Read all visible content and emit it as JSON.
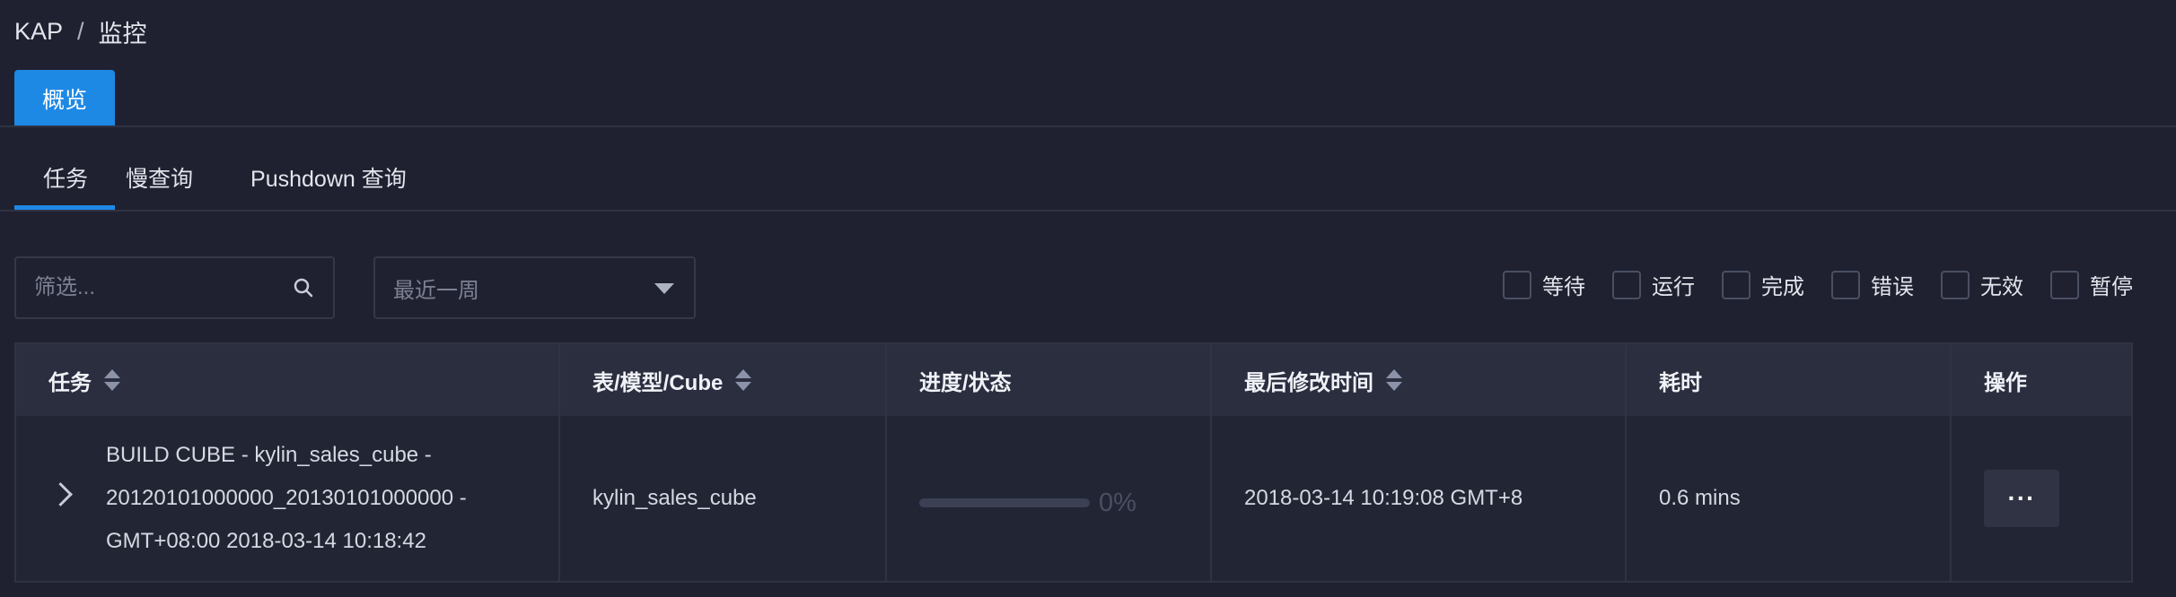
{
  "breadcrumb": {
    "root": "KAP",
    "separator": "/",
    "current": "监控"
  },
  "main_tab": {
    "label": "概览"
  },
  "subtabs": [
    {
      "label": "任务",
      "active": true
    },
    {
      "label": "慢查询",
      "active": false
    },
    {
      "label": "Pushdown 查询",
      "active": false
    }
  ],
  "filter": {
    "placeholder": "筛选...",
    "value": ""
  },
  "period_select": {
    "value": "最近一周"
  },
  "status_filters": [
    {
      "label": "等待",
      "checked": false
    },
    {
      "label": "运行",
      "checked": false
    },
    {
      "label": "完成",
      "checked": false
    },
    {
      "label": "错误",
      "checked": false
    },
    {
      "label": "无效",
      "checked": false
    },
    {
      "label": "暂停",
      "checked": false
    }
  ],
  "table": {
    "columns": [
      "任务",
      "表/模型/Cube",
      "进度/状态",
      "最后修改时间",
      "耗时",
      "操作"
    ],
    "rows": [
      {
        "task": "BUILD CUBE - kylin_sales_cube - 20120101000000_20130101000000 - GMT+08:00 2018-03-14 10:18:42",
        "target": "kylin_sales_cube",
        "progress_percent": 0,
        "progress_label": "0%",
        "last_modified": "2018-03-14 10:19:08 GMT+8",
        "duration": "0.6 mins",
        "action_label": "···"
      }
    ]
  },
  "colors": {
    "accent": "#1e88e5",
    "background": "#1f2130",
    "header_bg": "#2a2e3f"
  }
}
